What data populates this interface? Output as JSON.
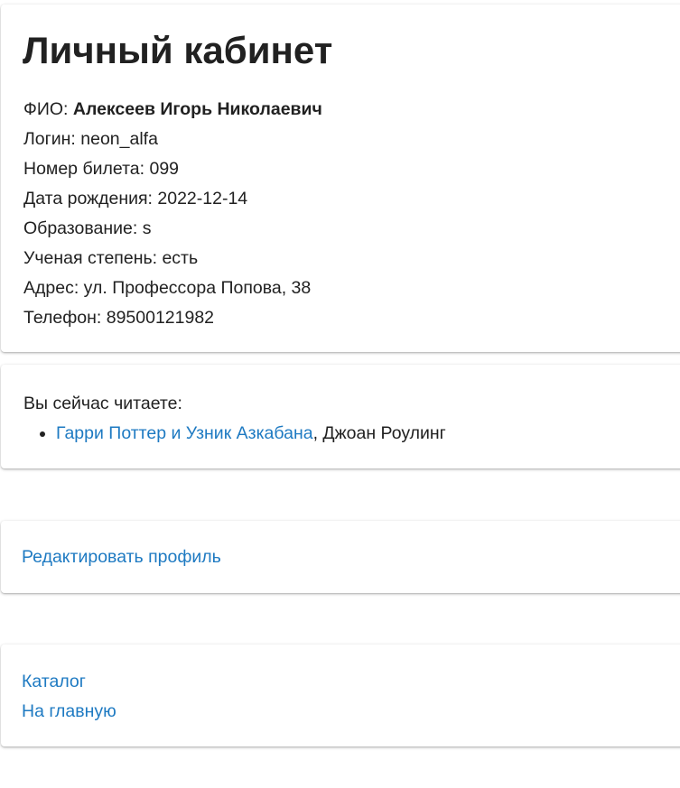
{
  "profile": {
    "title": "Личный кабинет",
    "fio_label": "ФИО:",
    "fio_value": "Алексеев Игорь Николаевич",
    "login": "Логин: neon_alfa",
    "ticket": "Номер билета: 099",
    "birth_date": "Дата рождения: 2022-12-14",
    "education": "Образование: s",
    "degree": "Ученая степень: есть",
    "address": "Адрес: ул. Профессора Попова, 38",
    "phone": "Телефон: 89500121982"
  },
  "reading": {
    "label": "Вы сейчас читаете:",
    "books": [
      {
        "title": "Гарри Поттер и Узник Азкабана",
        "author": ", Джоан Роулинг"
      }
    ]
  },
  "edit": {
    "label": "Редактировать профиль"
  },
  "nav": {
    "catalog": "Каталог",
    "home": "На главную"
  },
  "colors": {
    "link": "#1e7ac2",
    "text": "#212121"
  }
}
